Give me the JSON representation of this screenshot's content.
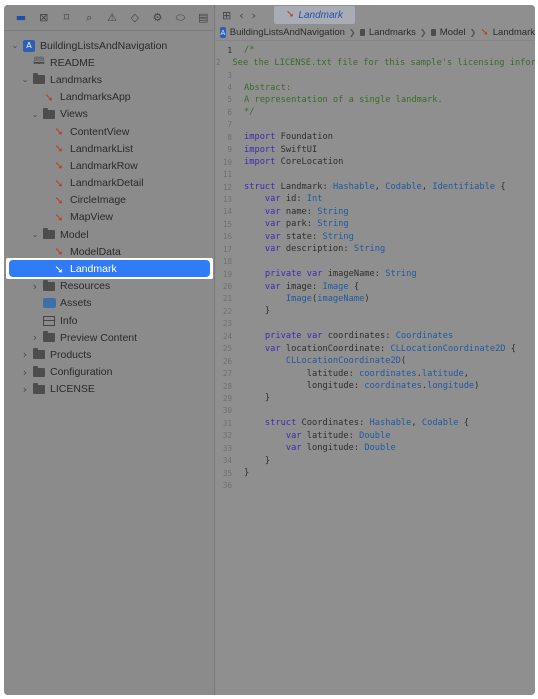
{
  "navigator": {
    "toolbar_icons": [
      "sidebar-icon",
      "source-control-icon",
      "bookmark-icon",
      "search-icon",
      "warning-icon",
      "test-icon",
      "debug-icon",
      "breakpoint-icon",
      "report-icon"
    ],
    "tree": [
      {
        "label": "BuildingListsAndNavigation",
        "kind": "project",
        "depth": 0,
        "expanded": true
      },
      {
        "label": "README",
        "kind": "book",
        "depth": 1
      },
      {
        "label": "Landmarks",
        "kind": "folder",
        "depth": 1,
        "expanded": true
      },
      {
        "label": "LandmarksApp",
        "kind": "swift",
        "depth": 2
      },
      {
        "label": "Views",
        "kind": "folder",
        "depth": 2,
        "expanded": true
      },
      {
        "label": "ContentView",
        "kind": "swift",
        "depth": 3
      },
      {
        "label": "LandmarkList",
        "kind": "swift",
        "depth": 3
      },
      {
        "label": "LandmarkRow",
        "kind": "swift",
        "depth": 3
      },
      {
        "label": "LandmarkDetail",
        "kind": "swift",
        "depth": 3
      },
      {
        "label": "CircleImage",
        "kind": "swift",
        "depth": 3
      },
      {
        "label": "MapView",
        "kind": "swift",
        "depth": 3
      },
      {
        "label": "Model",
        "kind": "folder",
        "depth": 2,
        "expanded": true
      },
      {
        "label": "ModelData",
        "kind": "swift",
        "depth": 3
      },
      {
        "label": "Landmark",
        "kind": "swift",
        "depth": 3,
        "selected": true
      },
      {
        "label": "Resources",
        "kind": "folder",
        "depth": 2,
        "expanded": false
      },
      {
        "label": "Assets",
        "kind": "assets",
        "depth": 2
      },
      {
        "label": "Info",
        "kind": "info",
        "depth": 2
      },
      {
        "label": "Preview Content",
        "kind": "folder",
        "depth": 2,
        "expanded": false
      },
      {
        "label": "Products",
        "kind": "folder",
        "depth": 1,
        "expanded": false
      },
      {
        "label": "Configuration",
        "kind": "folder",
        "depth": 1,
        "expanded": false
      },
      {
        "label": "LICENSE",
        "kind": "folder",
        "depth": 1,
        "expanded": false
      }
    ]
  },
  "editor": {
    "tab_label": "Landmark",
    "jumpbar": [
      "BuildingListsAndNavigation",
      "Landmarks",
      "Model",
      "Landmark"
    ],
    "current_line": 1,
    "code": [
      {
        "n": "1",
        "t": [
          [
            "cm",
            "/*"
          ]
        ]
      },
      {
        "n": "2",
        "t": [
          [
            "cm",
            "See the LICENSE.txt file for this sample's licensing information."
          ]
        ]
      },
      {
        "n": "3",
        "t": []
      },
      {
        "n": "4",
        "t": [
          [
            "cm",
            "Abstract:"
          ]
        ]
      },
      {
        "n": "5",
        "t": [
          [
            "cm",
            "A representation of a single landmark."
          ]
        ]
      },
      {
        "n": "6",
        "t": [
          [
            "cm",
            "*/"
          ]
        ]
      },
      {
        "n": "7",
        "t": []
      },
      {
        "n": "8",
        "t": [
          [
            "kw",
            "import"
          ],
          [
            "src",
            " Foundation"
          ]
        ]
      },
      {
        "n": "9",
        "t": [
          [
            "kw",
            "import"
          ],
          [
            "src",
            " SwiftUI"
          ]
        ]
      },
      {
        "n": "10",
        "t": [
          [
            "kw",
            "import"
          ],
          [
            "src",
            " CoreLocation"
          ]
        ]
      },
      {
        "n": "11",
        "t": []
      },
      {
        "n": "12",
        "t": [
          [
            "kw",
            "struct"
          ],
          [
            "src",
            " Landmark: "
          ],
          [
            "ty",
            "Hashable"
          ],
          [
            "src",
            ", "
          ],
          [
            "ty",
            "Codable"
          ],
          [
            "src",
            ", "
          ],
          [
            "ty",
            "Identifiable"
          ],
          [
            "src",
            " {"
          ]
        ]
      },
      {
        "n": "13",
        "t": [
          [
            "src",
            "    "
          ],
          [
            "kw",
            "var"
          ],
          [
            "src",
            " id: "
          ],
          [
            "ty",
            "Int"
          ]
        ]
      },
      {
        "n": "14",
        "t": [
          [
            "src",
            "    "
          ],
          [
            "kw",
            "var"
          ],
          [
            "src",
            " name: "
          ],
          [
            "ty",
            "String"
          ]
        ]
      },
      {
        "n": "15",
        "t": [
          [
            "src",
            "    "
          ],
          [
            "kw",
            "var"
          ],
          [
            "src",
            " park: "
          ],
          [
            "ty",
            "String"
          ]
        ]
      },
      {
        "n": "16",
        "t": [
          [
            "src",
            "    "
          ],
          [
            "kw",
            "var"
          ],
          [
            "src",
            " state: "
          ],
          [
            "ty",
            "String"
          ]
        ]
      },
      {
        "n": "17",
        "t": [
          [
            "src",
            "    "
          ],
          [
            "kw",
            "var"
          ],
          [
            "src",
            " description: "
          ],
          [
            "ty",
            "String"
          ]
        ]
      },
      {
        "n": "18",
        "t": []
      },
      {
        "n": "19",
        "t": [
          [
            "src",
            "    "
          ],
          [
            "kw",
            "private var"
          ],
          [
            "src",
            " imageName: "
          ],
          [
            "ty",
            "String"
          ]
        ]
      },
      {
        "n": "20",
        "t": [
          [
            "src",
            "    "
          ],
          [
            "kw",
            "var"
          ],
          [
            "src",
            " image: "
          ],
          [
            "ty",
            "Image"
          ],
          [
            "src",
            " {"
          ]
        ]
      },
      {
        "n": "21",
        "t": [
          [
            "src",
            "        "
          ],
          [
            "ty",
            "Image"
          ],
          [
            "src",
            "("
          ],
          [
            "ty",
            "imageName"
          ],
          [
            "src",
            ")"
          ]
        ]
      },
      {
        "n": "22",
        "t": [
          [
            "src",
            "    }"
          ]
        ]
      },
      {
        "n": "23",
        "t": []
      },
      {
        "n": "24",
        "t": [
          [
            "src",
            "    "
          ],
          [
            "kw",
            "private var"
          ],
          [
            "src",
            " coordinates: "
          ],
          [
            "ty",
            "Coordinates"
          ]
        ]
      },
      {
        "n": "25",
        "t": [
          [
            "src",
            "    "
          ],
          [
            "kw",
            "var"
          ],
          [
            "src",
            " locationCoordinate: "
          ],
          [
            "ty",
            "CLLocationCoordinate2D"
          ],
          [
            "src",
            " {"
          ]
        ]
      },
      {
        "n": "26",
        "t": [
          [
            "src",
            "        "
          ],
          [
            "ty",
            "CLLocationCoordinate2D"
          ],
          [
            "src",
            "("
          ]
        ]
      },
      {
        "n": "27",
        "t": [
          [
            "src",
            "            latitude: "
          ],
          [
            "ty",
            "coordinates"
          ],
          [
            "src",
            "."
          ],
          [
            "ty",
            "latitude"
          ],
          [
            "src",
            ","
          ]
        ]
      },
      {
        "n": "28",
        "t": [
          [
            "src",
            "            longitude: "
          ],
          [
            "ty",
            "coordinates"
          ],
          [
            "src",
            "."
          ],
          [
            "ty",
            "longitude"
          ],
          [
            "src",
            ")"
          ]
        ]
      },
      {
        "n": "29",
        "t": [
          [
            "src",
            "    }"
          ]
        ]
      },
      {
        "n": "30",
        "t": []
      },
      {
        "n": "31",
        "t": [
          [
            "src",
            "    "
          ],
          [
            "kw",
            "struct"
          ],
          [
            "src",
            " Coordinates: "
          ],
          [
            "ty",
            "Hashable"
          ],
          [
            "src",
            ", "
          ],
          [
            "ty",
            "Codable"
          ],
          [
            "src",
            " {"
          ]
        ]
      },
      {
        "n": "32",
        "t": [
          [
            "src",
            "        "
          ],
          [
            "kw",
            "var"
          ],
          [
            "src",
            " latitude: "
          ],
          [
            "ty",
            "Double"
          ]
        ]
      },
      {
        "n": "33",
        "t": [
          [
            "src",
            "        "
          ],
          [
            "kw",
            "var"
          ],
          [
            "src",
            " longitude: "
          ],
          [
            "ty",
            "Double"
          ]
        ]
      },
      {
        "n": "34",
        "t": [
          [
            "src",
            "    }"
          ]
        ]
      },
      {
        "n": "35",
        "t": [
          [
            "src",
            "}"
          ]
        ]
      },
      {
        "n": "36",
        "t": []
      }
    ]
  }
}
